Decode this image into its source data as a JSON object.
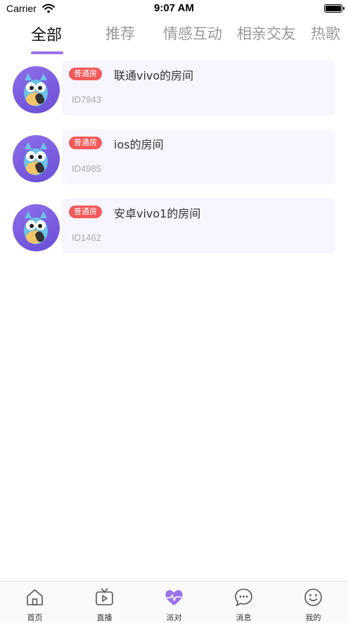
{
  "status_bar": {
    "carrier": "Carrier",
    "time": "9:07 AM"
  },
  "tabs": [
    {
      "label": "全部",
      "active": true
    },
    {
      "label": "推荐",
      "active": false
    },
    {
      "label": "情感互动",
      "active": false
    },
    {
      "label": "相亲交友",
      "active": false
    },
    {
      "label": "热歌",
      "active": false
    }
  ],
  "colors": {
    "accent": "#9b73e8",
    "tag": "#f25a5a",
    "card": "#f7f5ff"
  },
  "rooms": [
    {
      "tag": "普通房",
      "name": "联通vivo的房间",
      "id": "ID7943",
      "avatar_icon": "owl-avatar-icon"
    },
    {
      "tag": "普通房",
      "name": "ios的房间",
      "id": "ID4985",
      "avatar_icon": "owl-avatar-icon"
    },
    {
      "tag": "普通房",
      "name": "安卓vivo1的房间",
      "id": "ID1462",
      "avatar_icon": "owl-avatar-icon"
    }
  ],
  "bottom_nav": [
    {
      "label": "首页",
      "icon": "home-icon",
      "active": false
    },
    {
      "label": "直播",
      "icon": "tv-play-icon",
      "active": false
    },
    {
      "label": "派对",
      "icon": "heart-pulse-icon",
      "active": true
    },
    {
      "label": "消息",
      "icon": "chat-bubble-icon",
      "active": false
    },
    {
      "label": "我的",
      "icon": "smiley-icon",
      "active": false
    }
  ]
}
